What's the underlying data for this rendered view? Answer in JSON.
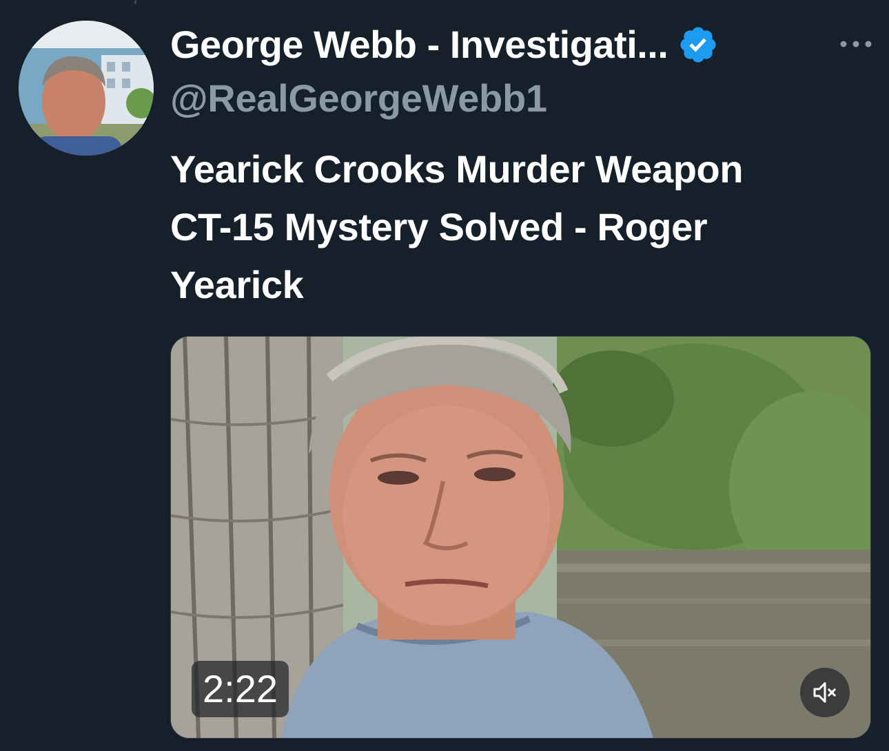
{
  "tweet": {
    "author": {
      "display_name": "George Webb - Investigati...",
      "handle": "@RealGeorgeWebb1",
      "verified": true,
      "avatar_icon": "profile-photo-icon"
    },
    "text_lines": [
      "Yearick Crooks Murder Weapon",
      "CT-15 Mystery Solved - Roger",
      "Yearick"
    ],
    "media": {
      "type": "video",
      "duration": "2:22",
      "muted": true,
      "mute_icon": "speaker-muted-icon"
    },
    "more_icon": "more-horizontal-icon"
  },
  "colors": {
    "background": "#16202b",
    "primary_text": "#ffffff",
    "secondary_text": "#8b98a5",
    "verified_badge": "#1d9bf0"
  }
}
